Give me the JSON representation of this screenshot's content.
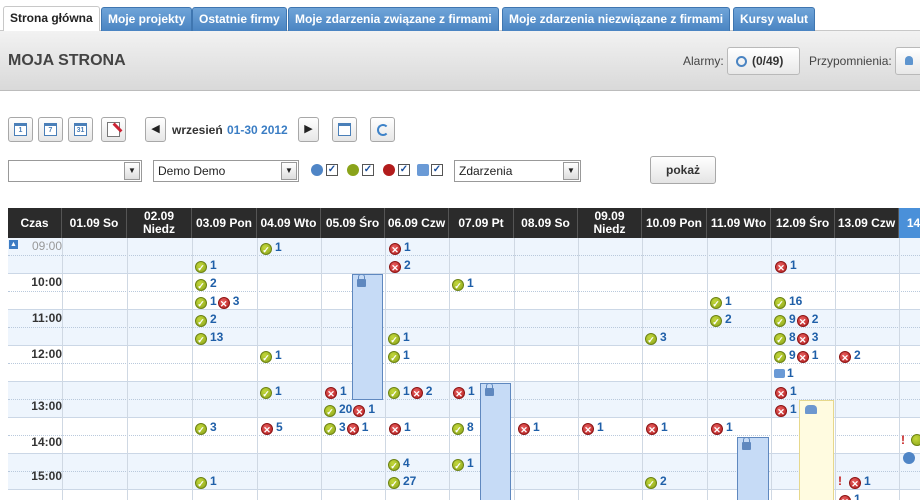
{
  "tabs": [
    {
      "label": "Strona główna",
      "active": true
    },
    {
      "label": "Moje projekty",
      "active": false
    },
    {
      "label": "Ostatnie firmy",
      "active": false
    },
    {
      "label": "Moje zdarzenia związane z firmami",
      "active": false
    },
    {
      "label": "Moje zdarzenia niezwiązane z firmami",
      "active": false
    },
    {
      "label": "Kursy walut",
      "active": false
    }
  ],
  "header": {
    "title": "MOJA STRONA",
    "alarm_label": "Alarmy:",
    "alarm_count": "(0/49)",
    "reminder_label": "Przypomnienia:"
  },
  "toolbar": {
    "period_month": "wrzesień",
    "period_range": "01-30 2012",
    "prev_label": "◀",
    "next_label": "▶"
  },
  "filters": {
    "select1_value": "",
    "select2_value": "Demo Demo",
    "select3_value": "Zdarzenia",
    "show_label": "pokaż"
  },
  "grid": {
    "header_time": "Czas",
    "columns": [
      "01.09 So",
      "02.09 Niedz",
      "03.09 Pon",
      "04.09 Wto",
      "05.09 Śro",
      "06.09 Czw",
      "07.09 Pt",
      "08.09 So",
      "09.09 Niedz",
      "10.09 Pon",
      "11.09 Wto",
      "12.09 Śro",
      "13.09 Czw",
      "14"
    ],
    "times": [
      "09:00",
      "10:00",
      "11:00",
      "12:00",
      "13:00",
      "14:00",
      "15:00"
    ]
  },
  "events": [
    {
      "col": 3,
      "row": 0,
      "parts": [
        [
          "ok",
          "1"
        ]
      ]
    },
    {
      "col": 5,
      "row": 0,
      "parts": [
        [
          "no",
          "1"
        ]
      ]
    },
    {
      "col": 2,
      "row": 1,
      "parts": [
        [
          "ok",
          "1"
        ]
      ]
    },
    {
      "col": 5,
      "row": 1,
      "parts": [
        [
          "no",
          "2"
        ]
      ]
    },
    {
      "col": 11,
      "row": 1,
      "parts": [
        [
          "no",
          "1"
        ]
      ]
    },
    {
      "col": 2,
      "row": 2,
      "parts": [
        [
          "ok",
          "2"
        ]
      ]
    },
    {
      "col": 6,
      "row": 2,
      "parts": [
        [
          "ok",
          "1"
        ]
      ]
    },
    {
      "col": 2,
      "row": 3,
      "parts": [
        [
          "ok",
          "1"
        ],
        [
          "no",
          "3"
        ]
      ]
    },
    {
      "col": 10,
      "row": 3,
      "parts": [
        [
          "ok",
          "1"
        ]
      ]
    },
    {
      "col": 11,
      "row": 3,
      "parts": [
        [
          "ok",
          "16"
        ]
      ]
    },
    {
      "col": 2,
      "row": 4,
      "parts": [
        [
          "ok",
          "2"
        ]
      ]
    },
    {
      "col": 10,
      "row": 4,
      "parts": [
        [
          "ok",
          "2"
        ]
      ]
    },
    {
      "col": 11,
      "row": 4,
      "parts": [
        [
          "ok",
          "9"
        ],
        [
          "no",
          "2"
        ]
      ]
    },
    {
      "col": 2,
      "row": 5,
      "parts": [
        [
          "ok",
          "13"
        ]
      ]
    },
    {
      "col": 5,
      "row": 5,
      "parts": [
        [
          "ok",
          "1"
        ]
      ]
    },
    {
      "col": 9,
      "row": 5,
      "parts": [
        [
          "ok",
          "3"
        ]
      ]
    },
    {
      "col": 11,
      "row": 5,
      "parts": [
        [
          "ok",
          "8"
        ],
        [
          "no",
          "3"
        ]
      ]
    },
    {
      "col": 3,
      "row": 6,
      "parts": [
        [
          "ok",
          "1"
        ]
      ]
    },
    {
      "col": 5,
      "row": 6,
      "parts": [
        [
          "ok",
          "1"
        ]
      ]
    },
    {
      "col": 11,
      "row": 6,
      "parts": [
        [
          "ok",
          "9"
        ],
        [
          "no",
          "1"
        ]
      ]
    },
    {
      "col": 12,
      "row": 6,
      "parts": [
        [
          "no",
          "2"
        ]
      ]
    },
    {
      "col": 11,
      "row": 7,
      "parts": [
        [
          "bag",
          "1"
        ]
      ]
    },
    {
      "col": 3,
      "row": 8,
      "parts": [
        [
          "ok",
          "1"
        ]
      ]
    },
    {
      "col": 4,
      "row": 8,
      "parts": [
        [
          "no",
          "1"
        ]
      ]
    },
    {
      "col": 5,
      "row": 8,
      "parts": [
        [
          "ok",
          "1"
        ],
        [
          "no",
          "2"
        ]
      ]
    },
    {
      "col": 6,
      "row": 8,
      "parts": [
        [
          "no",
          "1"
        ]
      ]
    },
    {
      "col": 11,
      "row": 8,
      "parts": [
        [
          "no",
          "1"
        ]
      ]
    },
    {
      "col": 4,
      "row": 9,
      "parts": [
        [
          "ok",
          "20"
        ],
        [
          "no",
          "1"
        ]
      ]
    },
    {
      "col": 11,
      "row": 9,
      "parts": [
        [
          "no",
          "1"
        ]
      ]
    },
    {
      "col": 2,
      "row": 10,
      "parts": [
        [
          "ok",
          "3"
        ]
      ]
    },
    {
      "col": 3,
      "row": 10,
      "parts": [
        [
          "no",
          "5"
        ]
      ]
    },
    {
      "col": 4,
      "row": 10,
      "parts": [
        [
          "ok",
          "3"
        ],
        [
          "no",
          "1"
        ]
      ]
    },
    {
      "col": 5,
      "row": 10,
      "parts": [
        [
          "no",
          "1"
        ]
      ]
    },
    {
      "col": 6,
      "row": 10,
      "parts": [
        [
          "ok",
          "8"
        ]
      ]
    },
    {
      "col": 7,
      "row": 10,
      "parts": [
        [
          "no",
          "1"
        ]
      ]
    },
    {
      "col": 8,
      "row": 10,
      "parts": [
        [
          "no",
          "1"
        ]
      ]
    },
    {
      "col": 9,
      "row": 10,
      "parts": [
        [
          "no",
          "1"
        ]
      ]
    },
    {
      "col": 10,
      "row": 10,
      "parts": [
        [
          "no",
          "1"
        ]
      ]
    },
    {
      "col": 5,
      "row": 12,
      "parts": [
        [
          "ok",
          "4"
        ]
      ]
    },
    {
      "col": 6,
      "row": 12,
      "parts": [
        [
          "ok",
          "1"
        ]
      ]
    },
    {
      "col": 2,
      "row": 13,
      "parts": [
        [
          "ok",
          "1"
        ]
      ]
    },
    {
      "col": 5,
      "row": 13,
      "parts": [
        [
          "ok",
          "27"
        ]
      ]
    },
    {
      "col": 9,
      "row": 13,
      "parts": [
        [
          "ok",
          "2"
        ]
      ]
    },
    {
      "col": 12,
      "row": 13,
      "parts": [
        [
          "excl",
          "!"
        ],
        [
          "no",
          "1"
        ]
      ]
    },
    {
      "col": 12,
      "row": 14,
      "parts": [
        [
          "no",
          "1"
        ]
      ]
    }
  ],
  "colors": {
    "accent": "#4a84c2",
    "ok": "#8aa31a",
    "cancel": "#b21c1c",
    "today": "#4a90d9"
  }
}
